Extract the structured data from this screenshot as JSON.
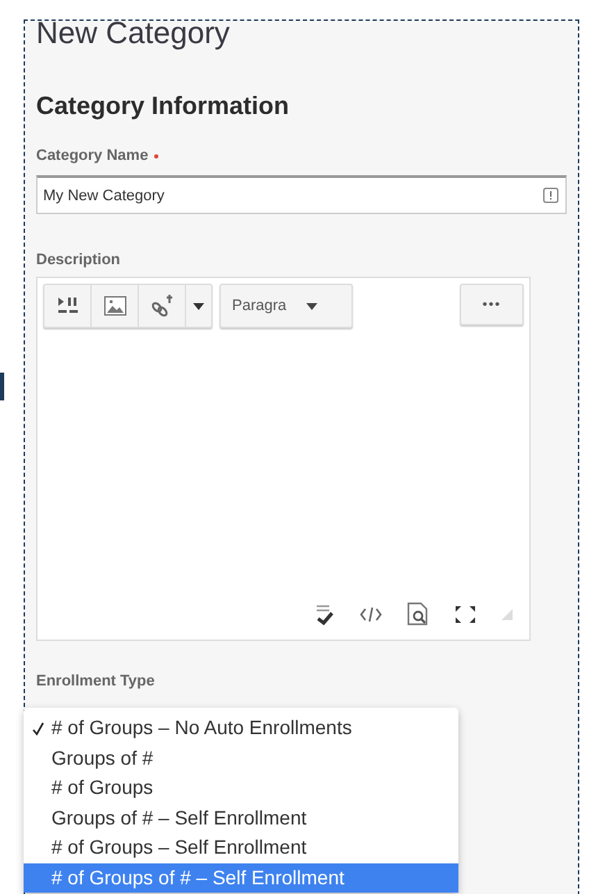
{
  "page": {
    "title": "New Category"
  },
  "section": {
    "title": "Category Information"
  },
  "name_field": {
    "label": "Category Name",
    "required": true,
    "value": "My New Category"
  },
  "description": {
    "label": "Description",
    "format": "Paragra",
    "more": "•••"
  },
  "enrollment": {
    "label": "Enrollment Type",
    "options": [
      {
        "label": "# of Groups – No Auto Enrollments",
        "checked": true,
        "selected": false
      },
      {
        "label": "Groups of #",
        "checked": false,
        "selected": false
      },
      {
        "label": "# of Groups",
        "checked": false,
        "selected": false
      },
      {
        "label": "Groups of # – Self Enrollment",
        "checked": false,
        "selected": false
      },
      {
        "label": "# of Groups – Self Enrollment",
        "checked": false,
        "selected": false
      },
      {
        "label": "# of Groups of # – Self Enrollment",
        "checked": false,
        "selected": true
      }
    ]
  }
}
